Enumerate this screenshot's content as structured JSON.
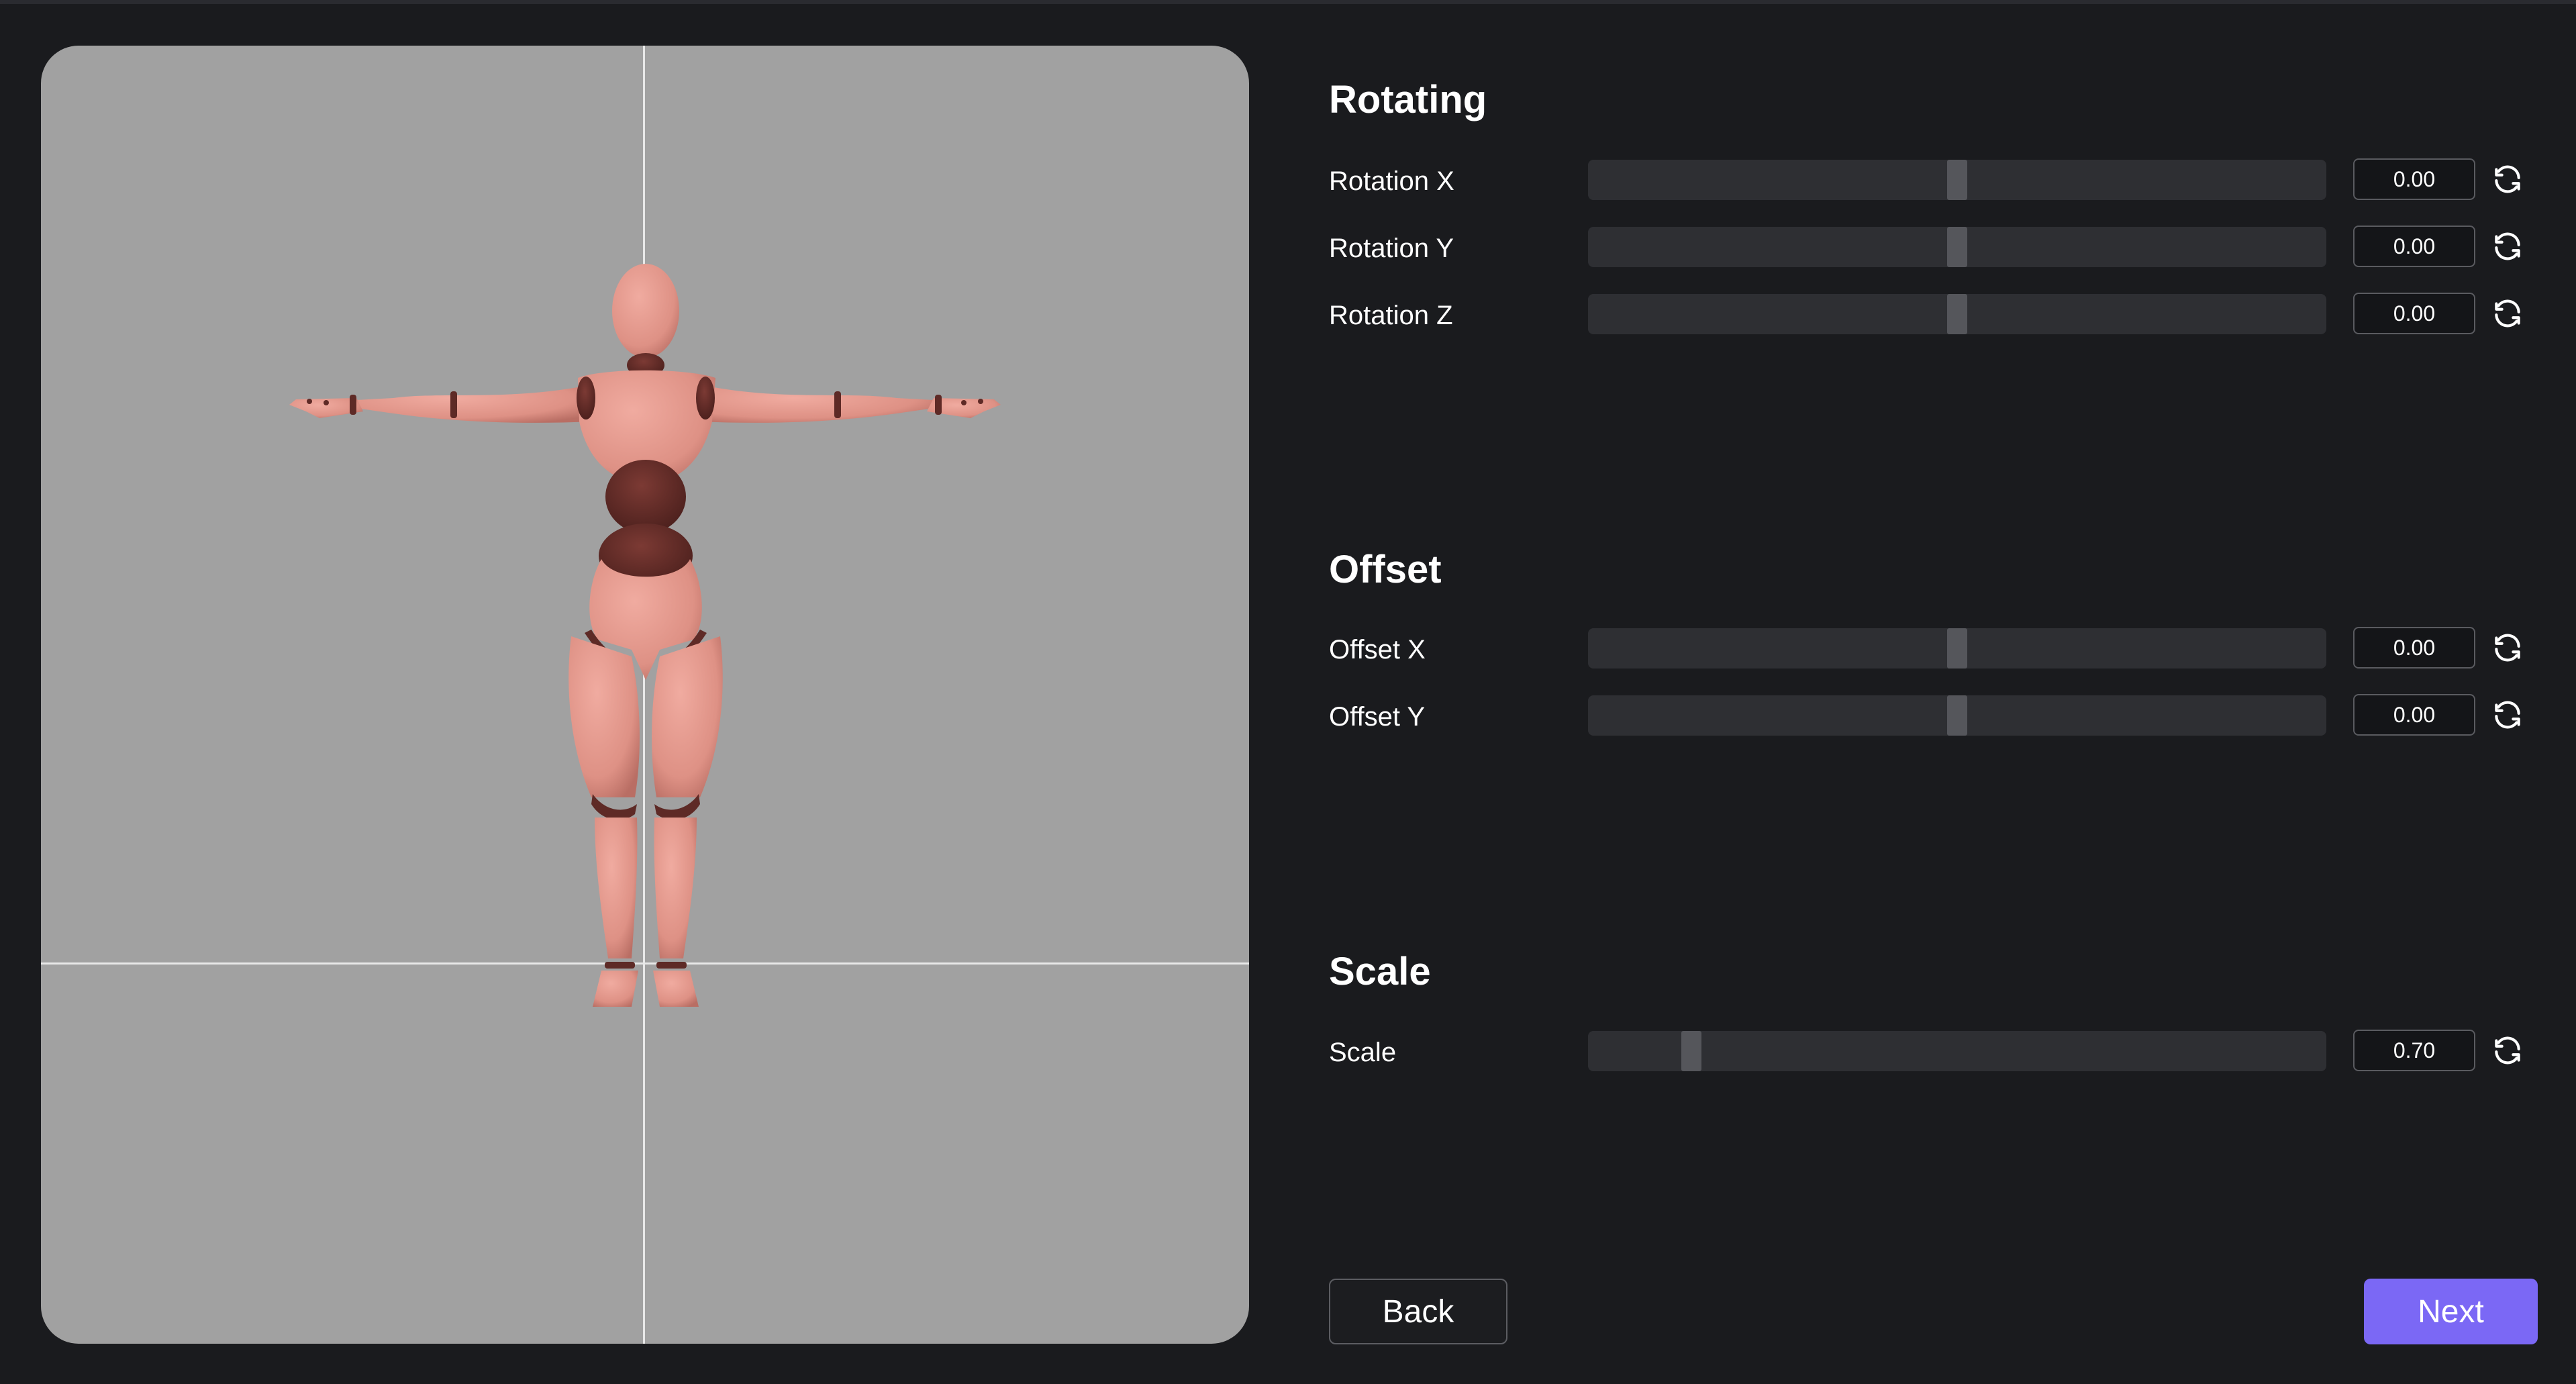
{
  "sections": {
    "rotating": {
      "title": "Rotating",
      "rows": [
        {
          "label": "Rotation X",
          "value": "0.00",
          "slider_fraction": 0.5
        },
        {
          "label": "Rotation Y",
          "value": "0.00",
          "slider_fraction": 0.5
        },
        {
          "label": "Rotation Z",
          "value": "0.00",
          "slider_fraction": 0.5
        }
      ]
    },
    "offset": {
      "title": "Offset",
      "rows": [
        {
          "label": "Offset X",
          "value": "0.00",
          "slider_fraction": 0.5
        },
        {
          "label": "Offset Y",
          "value": "0.00",
          "slider_fraction": 0.5
        }
      ]
    },
    "scale": {
      "title": "Scale",
      "rows": [
        {
          "label": "Scale",
          "value": "0.70",
          "slider_fraction": 0.14
        }
      ]
    }
  },
  "buttons": {
    "back": "Back",
    "next": "Next"
  },
  "icons": {
    "reset": "refresh-icon"
  },
  "colors": {
    "background": "#1a1b1e",
    "viewport": "#a1a1a1",
    "accent": "#7b68f5",
    "mannequin_skin": "#e0958a",
    "mannequin_joint": "#5e2a26"
  }
}
